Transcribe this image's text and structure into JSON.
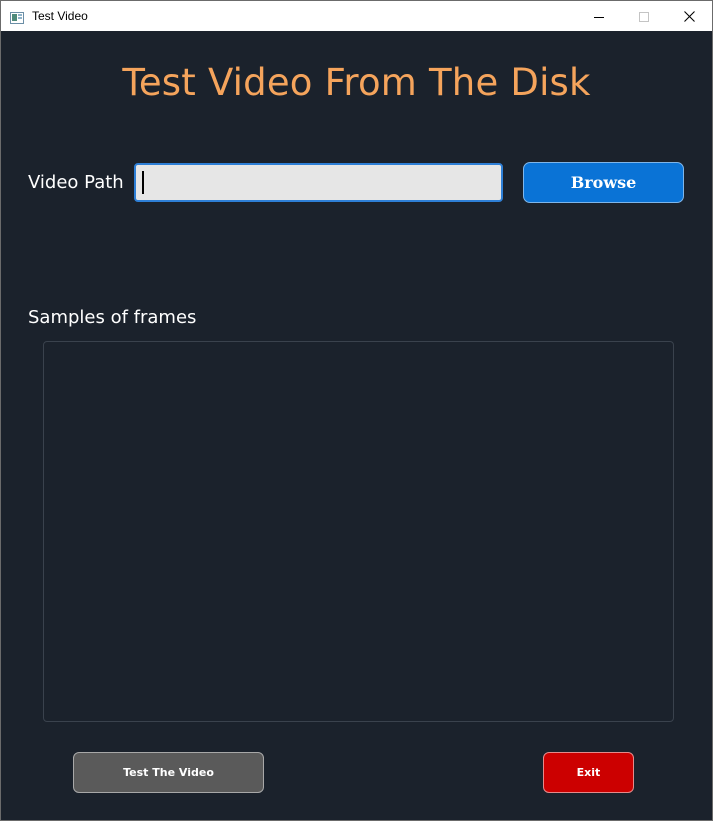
{
  "window": {
    "title": "Test Video",
    "controls": {
      "minimize": "minimize-icon",
      "maximize": "maximize-icon",
      "close": "close-icon"
    }
  },
  "main": {
    "heading": "Test Video From The Disk",
    "video_path_label": "Video Path",
    "video_path_value": "",
    "browse_label": "Browse",
    "samples_label": "Samples of frames",
    "test_button_label": "Test The Video",
    "exit_button_label": "Exit"
  },
  "colors": {
    "background": "#1b222c",
    "heading": "#f5a45c",
    "browse": "#0a73d6",
    "test_button": "#5a5a5a",
    "exit_button": "#cc0000"
  }
}
